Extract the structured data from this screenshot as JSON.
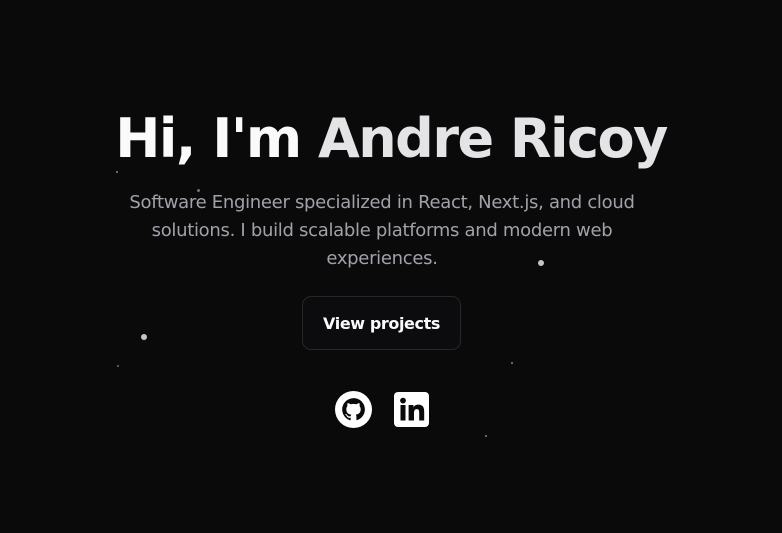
{
  "hero": {
    "title_greeting": "Hi, I'm ",
    "title_name": "Andre Ricoy",
    "subtitle": "Software Engineer specialized in React, Next.js, and cloud solutions. I build scalable platforms and modern web experiences.",
    "cta_label": "View projects"
  },
  "socials": [
    {
      "icon": "github-icon"
    },
    {
      "icon": "linkedin-icon"
    }
  ],
  "colors": {
    "background": "#0a0a0b",
    "heading": "#fafafa",
    "subtitle": "#a1a1aa",
    "button_border": "#27272a"
  }
}
